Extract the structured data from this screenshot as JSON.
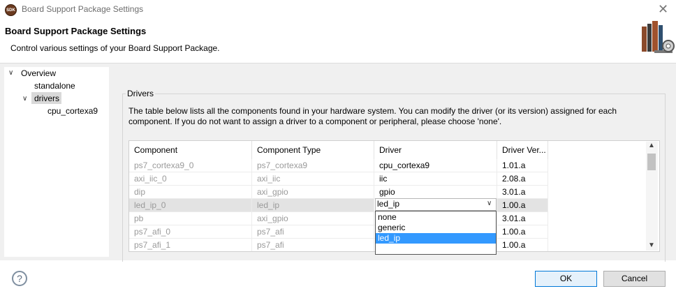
{
  "window": {
    "title": "Board Support Package Settings",
    "icon_text": "SDK"
  },
  "header": {
    "title": "Board Support Package Settings",
    "description": "Control various settings of your Board Support Package."
  },
  "tree": [
    {
      "label": "Overview",
      "expanded": true
    },
    {
      "label": "standalone"
    },
    {
      "label": "drivers",
      "expanded": true,
      "selected": true
    },
    {
      "label": "cpu_cortexa9"
    }
  ],
  "drivers_group": {
    "label": "Drivers",
    "description": "The table below lists all the components found in your hardware system. You can modify the driver (or its version) assigned for each component. If you do not want to assign a driver to a component or peripheral, please choose 'none'."
  },
  "table": {
    "columns": [
      "Component",
      "Component Type",
      "Driver",
      "Driver Ver..."
    ],
    "rows": [
      [
        "ps7_cortexa9_0",
        "ps7_cortexa9",
        "cpu_cortexa9",
        "1.01.a"
      ],
      [
        "axi_iic_0",
        "axi_iic",
        "iic",
        "2.08.a"
      ],
      [
        "dip",
        "axi_gpio",
        "gpio",
        "3.01.a"
      ],
      [
        "led_ip_0",
        "led_ip",
        "led_ip",
        "1.00.a"
      ],
      [
        "pb",
        "axi_gpio",
        "",
        "3.01.a"
      ],
      [
        "ps7_afi_0",
        "ps7_afi",
        "",
        "1.00.a"
      ],
      [
        "ps7_afi_1",
        "ps7_afi",
        "",
        "1.00.a"
      ]
    ]
  },
  "driver_dropdown": {
    "selected": "led_ip",
    "options": [
      "none",
      "generic",
      "led_ip"
    ],
    "highlighted": "led_ip"
  },
  "footer": {
    "ok_label": "OK",
    "cancel_label": "Cancel",
    "help_symbol": "?"
  }
}
